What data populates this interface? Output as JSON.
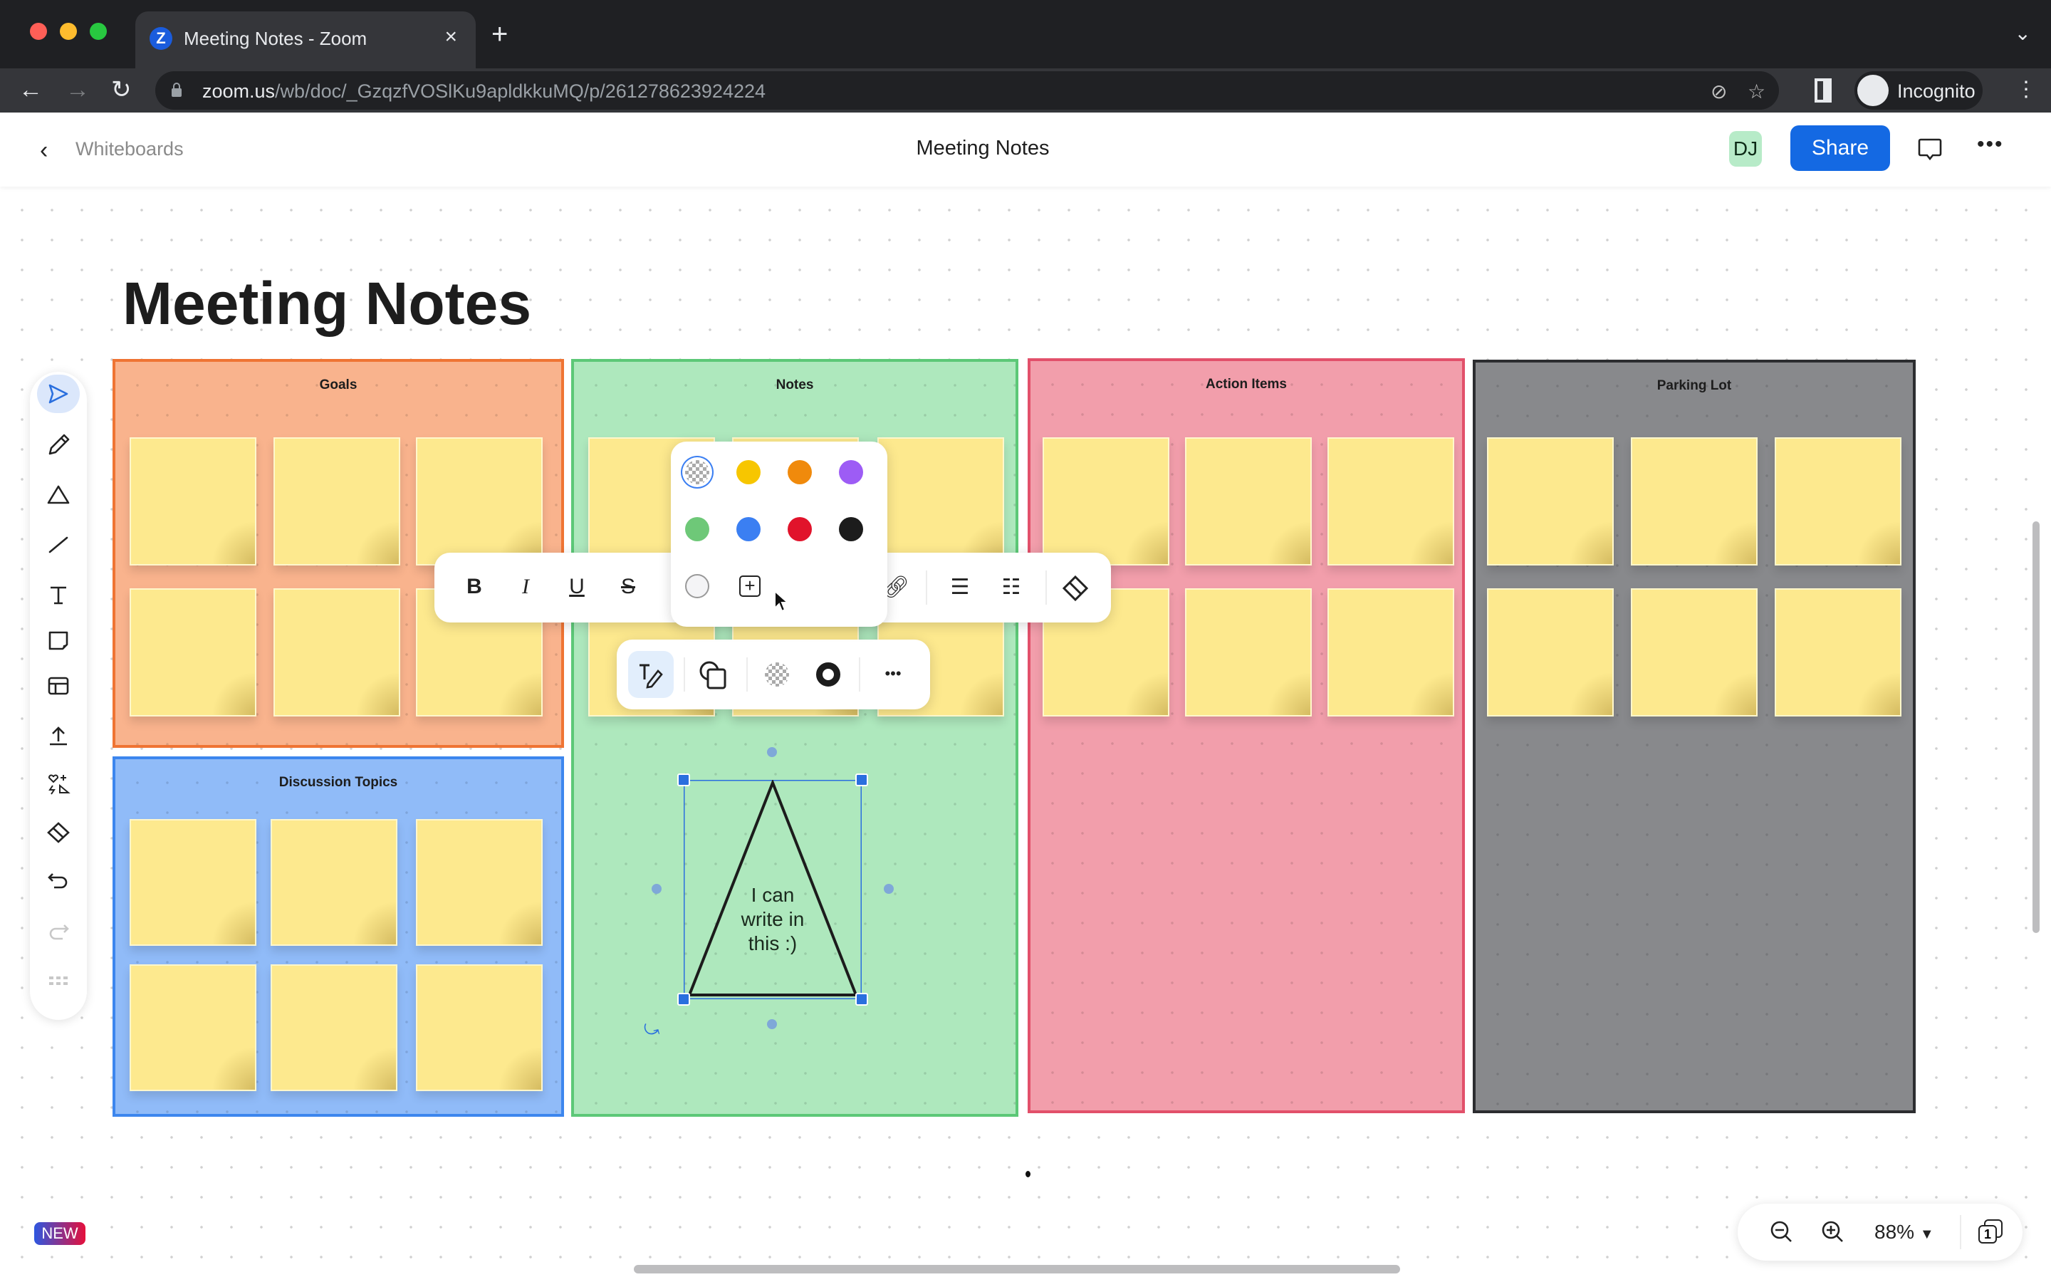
{
  "browser": {
    "tab_title": "Meeting Notes - Zoom",
    "tab_favicon_letter": "Z",
    "url_domain": "zoom.us",
    "url_path": "/wb/doc/_GzqzfVOSlKu9apldkkuMQ/p/261278623924224",
    "profile_label": "Incognito",
    "new_tab_glyph": "+",
    "close_glyph": "×",
    "tab_menu_glyph": "⌄"
  },
  "header": {
    "back_label": "Whiteboards",
    "title": "Meeting Notes",
    "avatar_initials": "DJ",
    "share_label": "Share",
    "more_glyph": "•••"
  },
  "board": {
    "title": "Meeting Notes",
    "frames": [
      {
        "title": "Goals",
        "fill": "#f9b38d",
        "border": "#ef7433",
        "sticky_count": 6
      },
      {
        "title": "Discussion Topics",
        "fill": "#90bbf8",
        "border": "#3c86ee",
        "sticky_count": 6
      },
      {
        "title": "Notes",
        "fill": "#aee8bd",
        "border": "#5cc877",
        "sticky_count": 6
      },
      {
        "title": "Action Items",
        "fill": "#f29eab",
        "border": "#e2506a",
        "sticky_count": 6
      },
      {
        "title": "Parking Lot",
        "fill": "#88898c",
        "border": "#2c2d30",
        "sticky_count": 6
      }
    ],
    "sticky_color": "#fde98e",
    "shape": {
      "type": "triangle",
      "text_lines": [
        "I can",
        "write in",
        "this :)"
      ],
      "selected": true
    }
  },
  "text_toolbar": {
    "bold": "B",
    "italic": "I",
    "underline": "U",
    "strike": "S"
  },
  "color_picker": {
    "selected": "transparent",
    "swatches": [
      "transparent",
      "#f7c600",
      "#f08a0c",
      "#9d5cf5",
      "#6ec878",
      "#3b7ff2",
      "#e1132b",
      "#1c1c1c",
      "#f4f4f6"
    ],
    "add_custom_label": "+"
  },
  "shape_toolbar": {
    "more_glyph": "•••"
  },
  "tools": [
    "select",
    "pen",
    "shapes",
    "line",
    "text",
    "sticky-note",
    "template",
    "upload",
    "stickers",
    "eraser",
    "undo",
    "redo",
    "more"
  ],
  "footer": {
    "new_badge": "NEW",
    "zoom_level": "88%",
    "page_count": "1"
  }
}
